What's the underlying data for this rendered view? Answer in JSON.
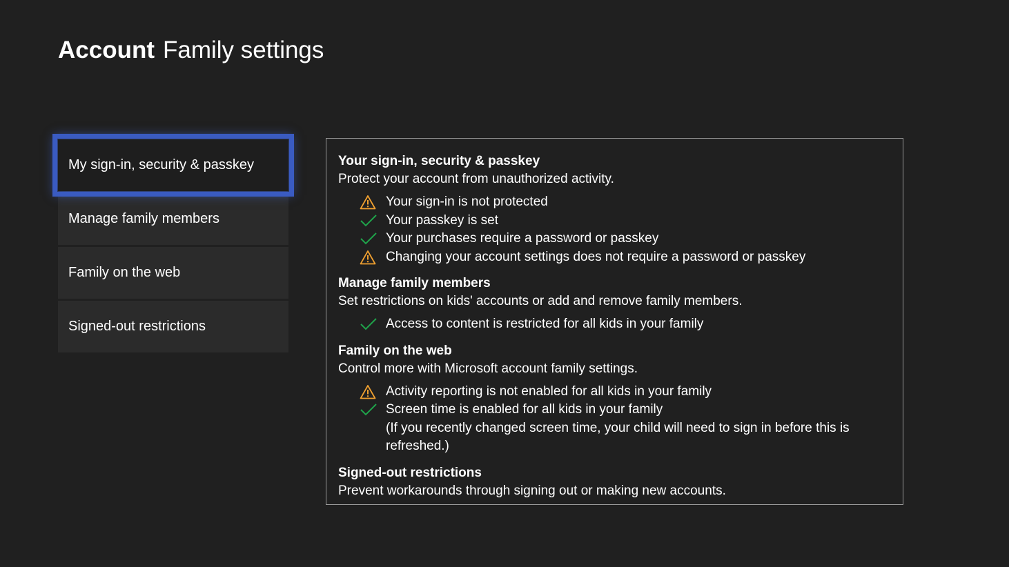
{
  "header": {
    "title_bold": "Account",
    "title_light": "Family settings"
  },
  "colors": {
    "background": "#202020",
    "accent_focus": "#3a5bc2",
    "warning": "#f0a030",
    "success": "#1fa34a"
  },
  "menu": {
    "items": [
      {
        "label": "My sign-in, security & passkey",
        "selected": true
      },
      {
        "label": "Manage family members",
        "selected": false
      },
      {
        "label": "Family on the web",
        "selected": false
      },
      {
        "label": "Signed-out restrictions",
        "selected": false
      }
    ]
  },
  "panel": {
    "sections": [
      {
        "title": "Your sign-in, security & passkey",
        "description": "Protect your account from unauthorized activity.",
        "items": [
          {
            "icon": "warning-icon",
            "text": "Your sign-in is not protected"
          },
          {
            "icon": "check-icon",
            "text": "Your passkey is set"
          },
          {
            "icon": "check-icon",
            "text": "Your purchases require a password or passkey"
          },
          {
            "icon": "warning-icon",
            "text": "Changing your account settings does not require a password or passkey"
          }
        ]
      },
      {
        "title": "Manage family members",
        "description": "Set restrictions on kids' accounts or add and remove family members.",
        "items": [
          {
            "icon": "check-icon",
            "text": "Access to content is restricted for all kids in your family"
          }
        ]
      },
      {
        "title": "Family on the web",
        "description": "Control more with Microsoft account family settings.",
        "items": [
          {
            "icon": "warning-icon",
            "text": "Activity reporting is not enabled for all kids in your family"
          },
          {
            "icon": "check-icon",
            "text": "Screen time is enabled for all kids in your family"
          },
          {
            "icon": "none",
            "text": "(If you recently changed screen time, your child will need to sign in before this is refreshed.)"
          }
        ]
      },
      {
        "title": "Signed-out restrictions",
        "description": "Prevent workarounds through signing out or making new accounts.",
        "items": []
      }
    ]
  }
}
